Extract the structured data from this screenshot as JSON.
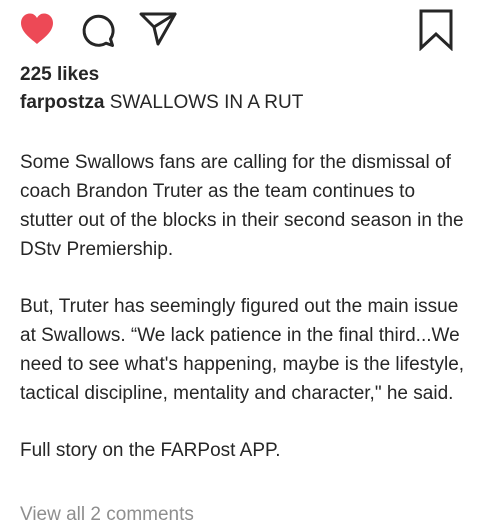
{
  "post": {
    "actions": {
      "like_icon": "heart-filled",
      "like_color": "#ed4956",
      "comment_icon": "speech-bubble",
      "share_icon": "paper-plane",
      "save_icon": "bookmark"
    },
    "likes_text": "225 likes",
    "caption": {
      "username": "farpostza",
      "headline": "SWALLOWS IN A RUT",
      "paragraphs": [
        "Some Swallows fans are calling for the dismissal of coach Brandon Truter as the team continues to stutter out of the blocks in their second season in the DStv Premiership.",
        "But, Truter has seemingly figured out the main issue at Swallows.  “We lack patience in the final third...We need to see what's happening, maybe is the lifestyle, tactical discipline, mentality and character,\" he said.",
        "Full story on the FARPost APP."
      ]
    },
    "view_comments_text": "View all 2 comments"
  }
}
